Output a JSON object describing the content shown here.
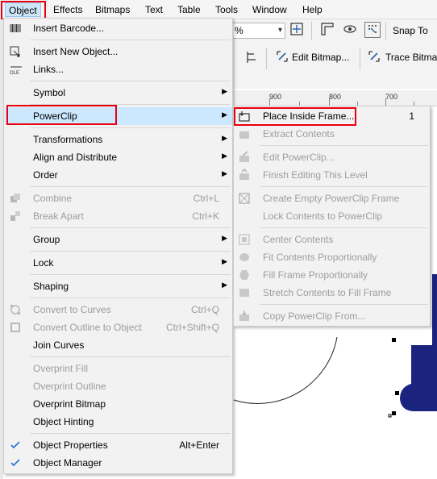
{
  "menubar": {
    "items": [
      "Object",
      "Effects",
      "Bitmaps",
      "Text",
      "Table",
      "Tools",
      "Window",
      "Help"
    ]
  },
  "toolbar": {
    "zoom_value": "%",
    "snap_label": "Snap To",
    "edit_bitmap_label": "Edit Bitmap...",
    "trace_bitmap_label": "Trace Bitmap"
  },
  "ruler": {
    "labels": [
      "900",
      "800",
      "700"
    ]
  },
  "object_menu": {
    "items": [
      {
        "label": "Insert Barcode..."
      },
      {
        "label": "Insert New Object..."
      },
      {
        "label": "Links..."
      },
      {
        "label": "Symbol"
      },
      {
        "label": "PowerClip"
      },
      {
        "label": "Transformations"
      },
      {
        "label": "Align and Distribute"
      },
      {
        "label": "Order"
      },
      {
        "label": "Combine",
        "shortcut": "Ctrl+L"
      },
      {
        "label": "Break Apart",
        "shortcut": "Ctrl+K"
      },
      {
        "label": "Group"
      },
      {
        "label": "Lock"
      },
      {
        "label": "Shaping"
      },
      {
        "label": "Convert to Curves",
        "shortcut": "Ctrl+Q"
      },
      {
        "label": "Convert Outline to Object",
        "shortcut": "Ctrl+Shift+Q"
      },
      {
        "label": "Join Curves"
      },
      {
        "label": "Overprint Fill"
      },
      {
        "label": "Overprint Outline"
      },
      {
        "label": "Overprint Bitmap"
      },
      {
        "label": "Object Hinting"
      },
      {
        "label": "Object Properties",
        "shortcut": "Alt+Enter"
      },
      {
        "label": "Object Manager"
      }
    ]
  },
  "powerclip_menu": {
    "items": [
      {
        "label": "Place Inside Frame...",
        "shortcut": "1"
      },
      {
        "label": "Extract Contents"
      },
      {
        "label": "Edit PowerClip..."
      },
      {
        "label": "Finish Editing This Level"
      },
      {
        "label": "Create Empty PowerClip Frame"
      },
      {
        "label": "Lock Contents to PowerClip"
      },
      {
        "label": "Center Contents"
      },
      {
        "label": "Fit Contents Proportionally"
      },
      {
        "label": "Fill Frame Proportionally"
      },
      {
        "label": "Stretch Contents to Fill Frame"
      },
      {
        "label": "Copy PowerClip From..."
      }
    ]
  },
  "colors": {
    "highlight": "#cce8ff",
    "annotation_red": "#e8000e",
    "disabled_text": "#9d9d9d",
    "shape_navy": "#1a237e",
    "check_blue": "#2b7bd6"
  }
}
